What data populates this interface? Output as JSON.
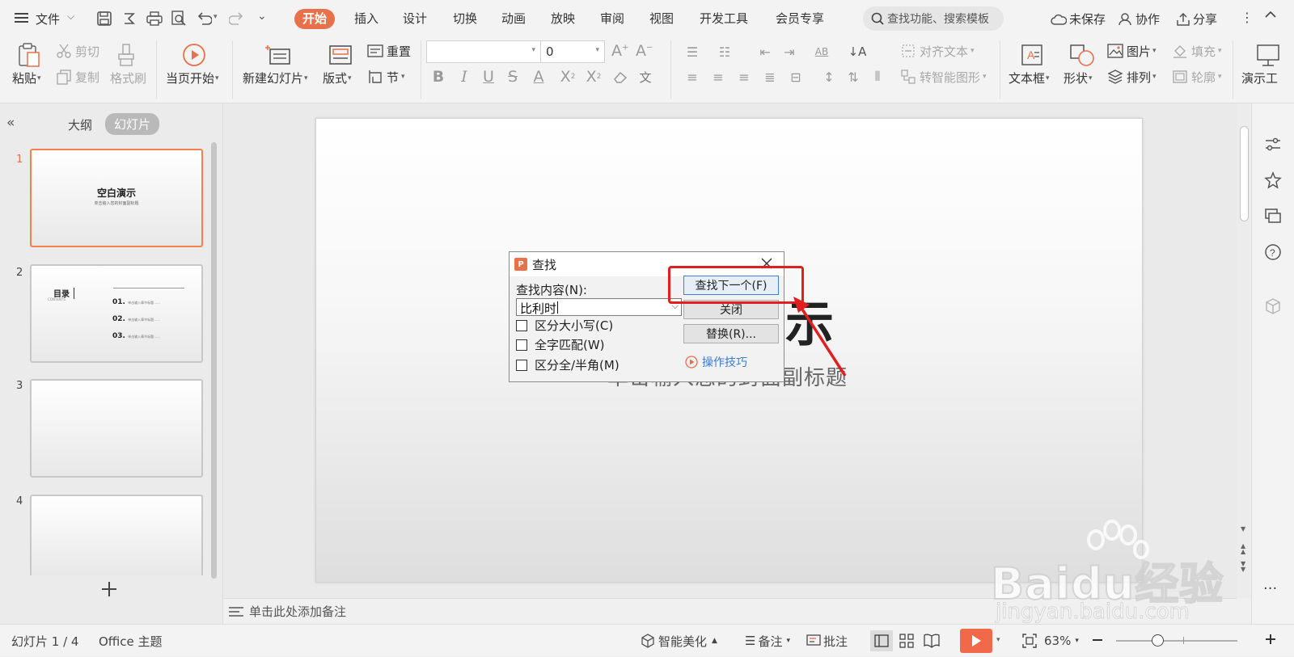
{
  "menubar": {
    "file_label": "文件",
    "tabs": [
      {
        "label": "开始",
        "active": true
      },
      {
        "label": "插入"
      },
      {
        "label": "设计"
      },
      {
        "label": "切换"
      },
      {
        "label": "动画"
      },
      {
        "label": "放映"
      },
      {
        "label": "审阅"
      },
      {
        "label": "视图"
      },
      {
        "label": "开发工具"
      },
      {
        "label": "会员专享"
      }
    ],
    "search_placeholder": "查找功能、搜索模板",
    "unsaved": "未保存",
    "collab": "协作",
    "share": "分享"
  },
  "ribbon": {
    "paste": "粘贴",
    "cut": "剪切",
    "copy": "复制",
    "format_painter": "格式刷",
    "from_current": "当页开始",
    "new_slide": "新建幻灯片",
    "layout": "版式",
    "reset": "重置",
    "section": "节",
    "font_size": "0",
    "align_text": "对齐文本",
    "smartart": "转智能图形",
    "textbox": "文本框",
    "shape": "形状",
    "picture": "图片",
    "arrange": "排列",
    "fill": "填充",
    "outline": "轮廓",
    "present": "演示工"
  },
  "leftpane": {
    "outline_tab": "大纲",
    "slides_tab": "幻灯片",
    "thumbs": [
      {
        "num": "1",
        "title": "空白演示",
        "subtitle": "单击输入您的封面副标题"
      },
      {
        "num": "2",
        "title": "目录",
        "sub": "CONTENTS",
        "items": [
          "01.",
          "02.",
          "03."
        ],
        "item_text": "单击输入章节标题……"
      },
      {
        "num": "3"
      },
      {
        "num": "4"
      }
    ]
  },
  "slide": {
    "title_fragment": "示",
    "subtitle": "单击输入您的封面副标题"
  },
  "notes_placeholder": "单击此处添加备注",
  "dialog": {
    "title": "查找",
    "find_label": "查找内容(N):",
    "find_value": "比利时",
    "find_next": "查找下一个(F)",
    "close": "关闭",
    "replace": "替换(R)...",
    "match_case": "区分大小写(C)",
    "whole_word": "全字匹配(W)",
    "full_half": "区分全/半角(M)",
    "tips": "操作技巧"
  },
  "status": {
    "slide_info": "幻灯片 1 / 4",
    "theme": "Office 主题",
    "beautify": "智能美化",
    "notes": "备注",
    "comments": "批注",
    "zoom": "63%"
  },
  "watermark": {
    "brand": "Baidu经验",
    "url": "jingyan.baidu.com"
  },
  "colors": {
    "accent": "#e8704a",
    "highlight_box": "#e02020",
    "play_button": "#f1694a",
    "link": "#3a7bd5"
  }
}
